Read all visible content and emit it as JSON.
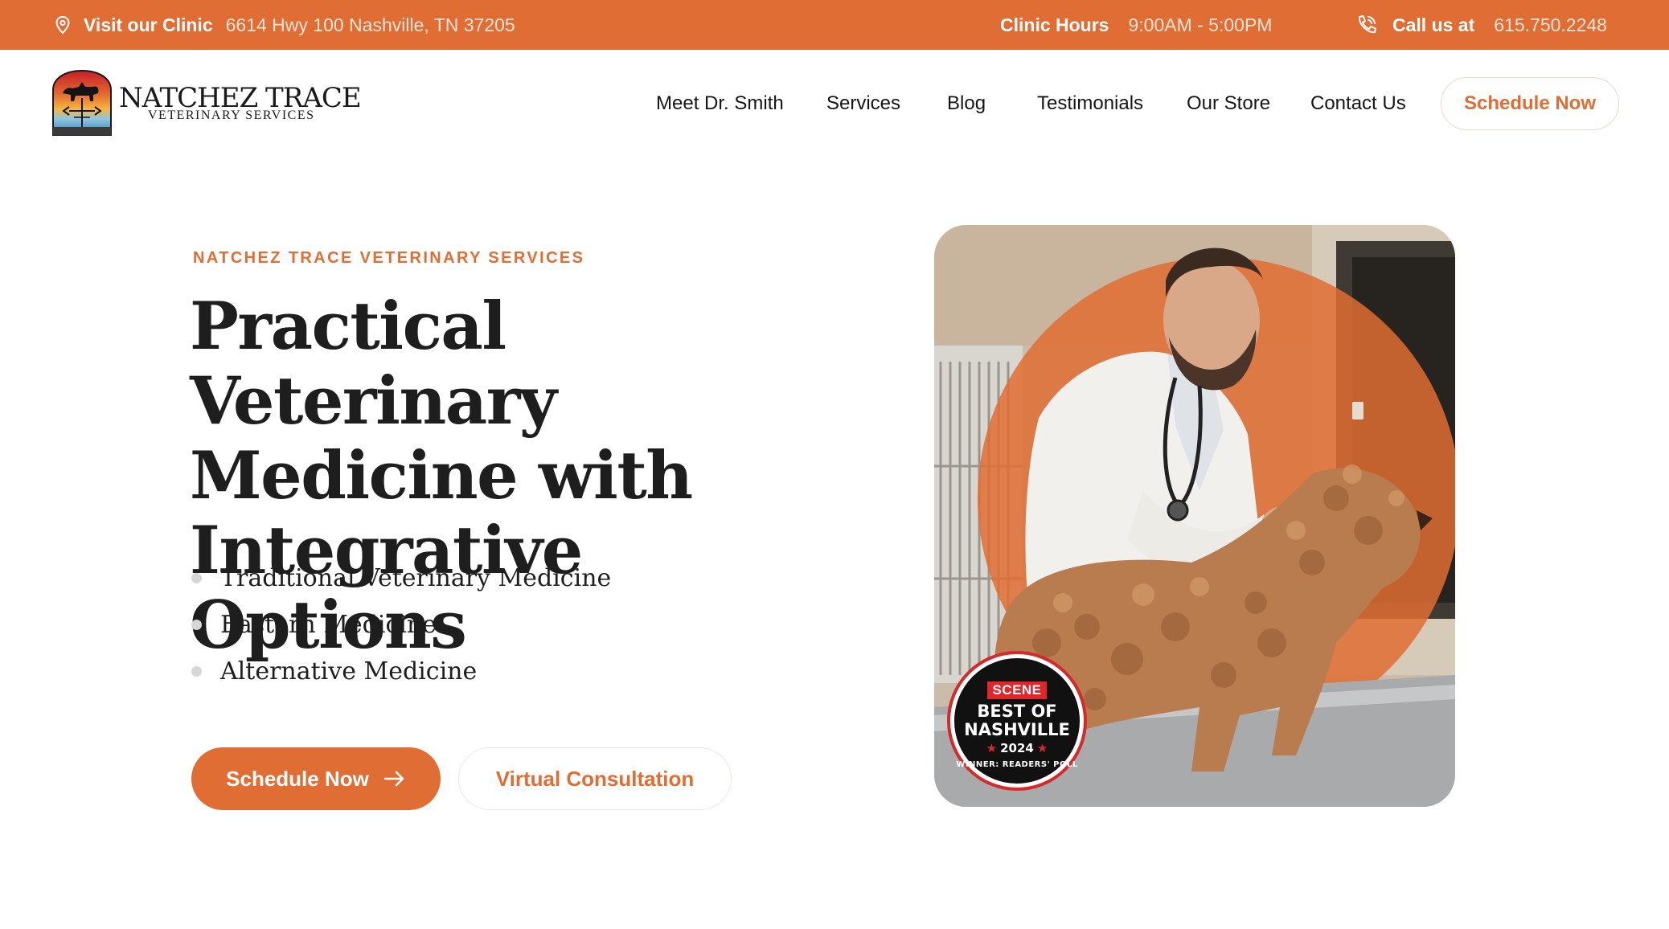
{
  "topbar": {
    "visit_label": "Visit our Clinic",
    "address": "6614 Hwy 100 Nashville, TN 37205",
    "hours_label": "Clinic Hours",
    "hours": "9:00AM - 5:00PM",
    "call_label": "Call us at",
    "phone": "615.750.2248",
    "icons": [
      "location-pin-icon",
      "phone-icon"
    ]
  },
  "brand": {
    "name": "NATCHEZ TRACE",
    "subtitle": "VETERINARY SERVICES"
  },
  "nav": {
    "items": [
      {
        "label": "Meet Dr. Smith"
      },
      {
        "label": "Services"
      },
      {
        "label": "Blog"
      },
      {
        "label": "Testimonials"
      },
      {
        "label": "Our Store"
      },
      {
        "label": "Contact Us"
      }
    ],
    "cta_label": "Schedule Now"
  },
  "hero": {
    "eyebrow": "NATCHEZ TRACE VETERINARY SERVICES",
    "headline": "Practical Veterinary Medicine with Integrative Options",
    "bullets": [
      "Traditional Veterinary Medicine",
      "Eastern Medicine",
      "Alternative Medicine"
    ],
    "primary_cta": "Schedule Now",
    "secondary_cta": "Virtual Consultation"
  },
  "badge": {
    "publication": "SCENE",
    "title": "BEST OF NASHVILLE",
    "year": "2024",
    "footer": "WINNER: READERS' POLL"
  },
  "colors": {
    "accent": "#E06D33",
    "text": "#1e1e1e",
    "badge_red": "#e0262b"
  }
}
